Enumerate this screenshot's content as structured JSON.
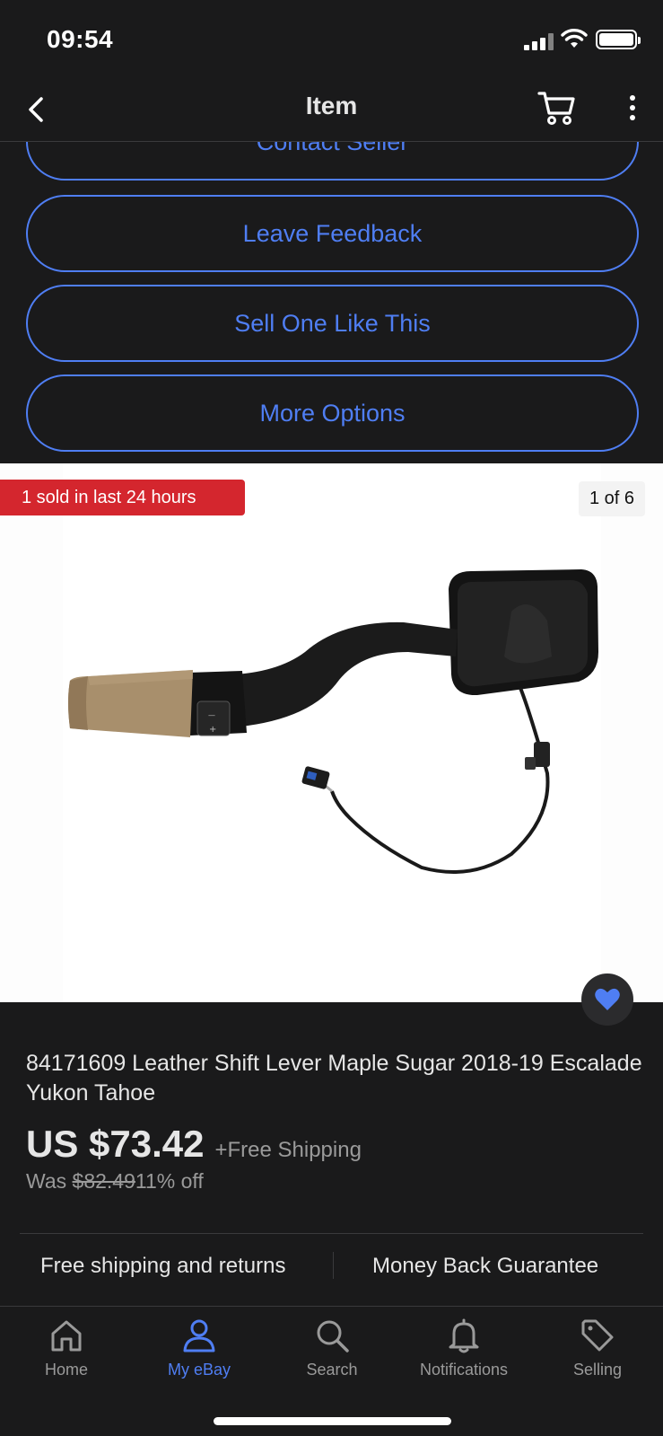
{
  "status": {
    "time": "09:54"
  },
  "header": {
    "title": "Item"
  },
  "actions": [
    {
      "label": "Contact Seller"
    },
    {
      "label": "Leave Feedback"
    },
    {
      "label": "Sell One Like This"
    },
    {
      "label": "More Options"
    }
  ],
  "gallery": {
    "sold_badge": "1 sold in last 24 hours",
    "image_counter": "1 of 6",
    "image_subject": "Leather Shift Lever with wiring harness"
  },
  "item": {
    "title": "84171609 Leather Shift Lever Maple Sugar 2018-19 Escalade Yukon Tahoe",
    "price": "US $73.42",
    "shipping": "+Free Shipping",
    "was_label": "Was",
    "was_price": "$82.49",
    "discount": "11% off"
  },
  "guarantees": {
    "left": "Free shipping and returns",
    "right": "Money Back Guarantee"
  },
  "tabs": [
    {
      "label": "Home",
      "icon": "home-icon",
      "active": false
    },
    {
      "label": "My eBay",
      "icon": "user-icon",
      "active": true
    },
    {
      "label": "Search",
      "icon": "search-icon",
      "active": false
    },
    {
      "label": "Notifications",
      "icon": "bell-icon",
      "active": false
    },
    {
      "label": "Selling",
      "icon": "tag-icon",
      "active": false
    }
  ],
  "colors": {
    "accent": "#4f7ef3",
    "background": "#1a1a1b",
    "badge_red": "#d4262e"
  }
}
